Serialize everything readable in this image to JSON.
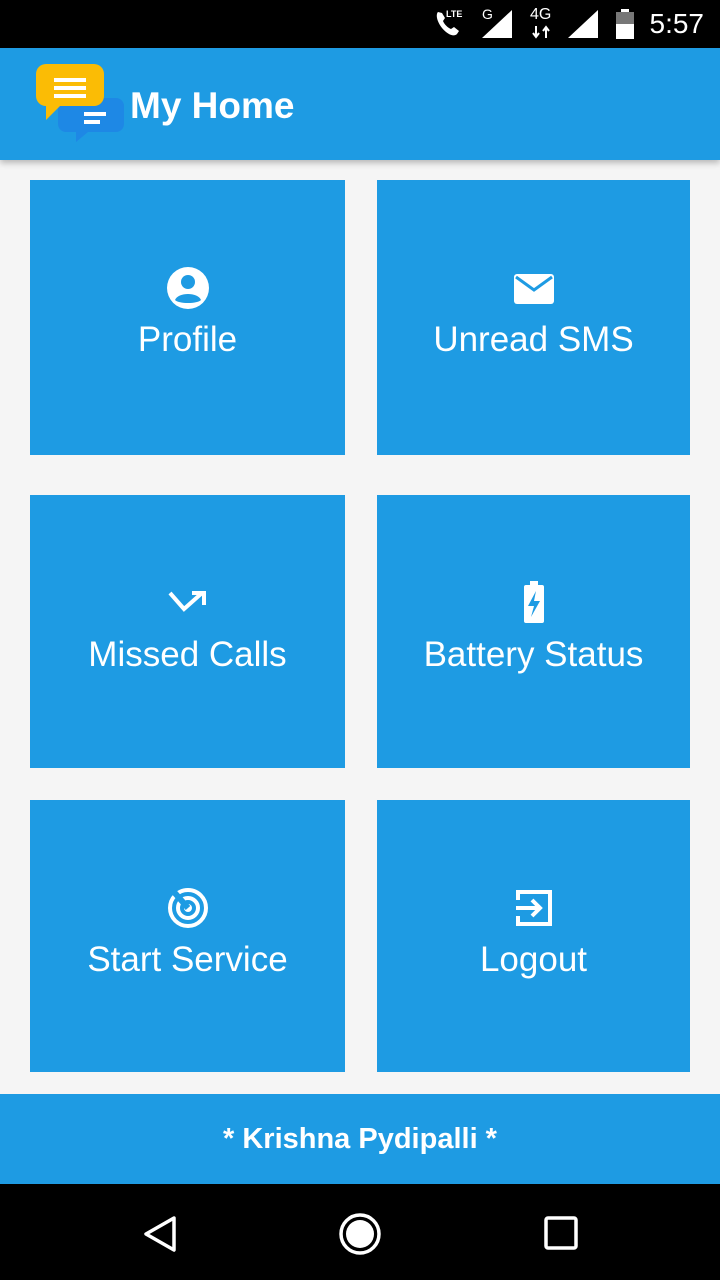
{
  "status_bar": {
    "time": "5:57",
    "network_label": "4G",
    "signal_label": "G",
    "lte_label": "LTE"
  },
  "app_bar": {
    "title": "My Home"
  },
  "tiles": [
    {
      "label": "Profile",
      "icon": "account-circle-icon"
    },
    {
      "label": "Unread SMS",
      "icon": "mail-icon"
    },
    {
      "label": "Missed Calls",
      "icon": "call-missed-icon"
    },
    {
      "label": "Battery Status",
      "icon": "battery-charging-icon"
    },
    {
      "label": "Start Service",
      "icon": "radar-icon"
    },
    {
      "label": "Logout",
      "icon": "exit-icon"
    }
  ],
  "footer": {
    "text": "* Krishna Pydipalli *"
  },
  "colors": {
    "primary": "#1e9be3",
    "background": "#f5f5f5",
    "accent_logo": "#fbbc05"
  }
}
